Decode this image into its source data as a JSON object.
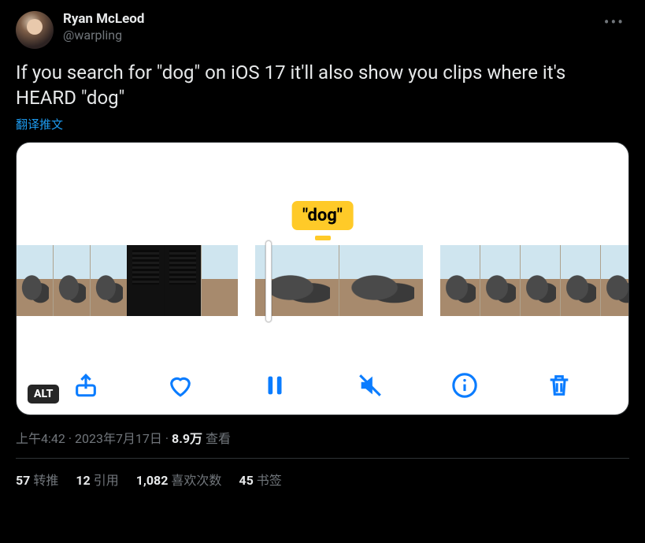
{
  "author": {
    "name": "Ryan McLeod",
    "handle": "@warpling"
  },
  "body": "If you search for \"dog\" on iOS 17 it'll also show you clips where it's HEARD \"dog\"",
  "translate_label": "翻译推文",
  "media": {
    "tag_text": "\"dog\"",
    "alt_badge": "ALT",
    "toolbar_icons": [
      "share",
      "heart",
      "pause",
      "mute",
      "info",
      "trash"
    ]
  },
  "timestamp": "上午4:42 · 2023年7月17日",
  "views": {
    "count": "8.9万",
    "label": "查看"
  },
  "stats": {
    "retweets": {
      "count": "57",
      "label": "转推"
    },
    "quotes": {
      "count": "12",
      "label": "引用"
    },
    "likes": {
      "count": "1,082",
      "label": "喜欢次数"
    },
    "bookmarks": {
      "count": "45",
      "label": "书签"
    }
  }
}
